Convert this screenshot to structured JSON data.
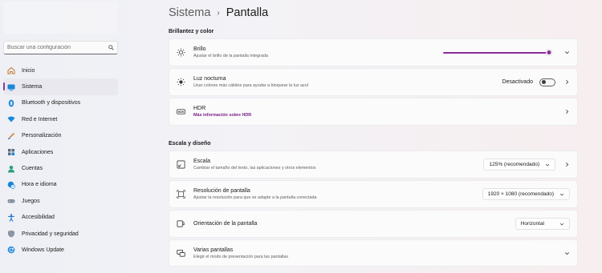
{
  "search": {
    "placeholder": "Buscar una configuración"
  },
  "sidebar": {
    "items": [
      {
        "label": "Inicio",
        "icon": "home-icon"
      },
      {
        "label": "Sistema",
        "icon": "system-icon",
        "active": true
      },
      {
        "label": "Bluetooth y dispositivos",
        "icon": "bluetooth-icon"
      },
      {
        "label": "Red e Internet",
        "icon": "wifi-icon"
      },
      {
        "label": "Personalización",
        "icon": "brush-icon"
      },
      {
        "label": "Aplicaciones",
        "icon": "apps-icon"
      },
      {
        "label": "Cuentas",
        "icon": "account-icon"
      },
      {
        "label": "Hora e idioma",
        "icon": "globe-clock-icon"
      },
      {
        "label": "Juegos",
        "icon": "gamepad-icon"
      },
      {
        "label": "Accesibilidad",
        "icon": "accessibility-icon"
      },
      {
        "label": "Privacidad y seguridad",
        "icon": "shield-icon"
      },
      {
        "label": "Windows Update",
        "icon": "update-icon"
      }
    ]
  },
  "breadcrumb": {
    "parent": "Sistema",
    "separator": "›",
    "current": "Pantalla"
  },
  "sections": {
    "brightness_color": "Brillantez y color",
    "scale_layout": "Escala y diseño"
  },
  "cards": {
    "brightness": {
      "title": "Brillo",
      "subtitle": "Ajustar el brillo de la pantalla integrada",
      "level": 0.97
    },
    "night_light": {
      "title": "Luz nocturna",
      "subtitle": "Usar colores más cálidos para ayudar a bloquear la luz azul",
      "state": "Desactivado"
    },
    "hdr": {
      "title": "HDR",
      "link": "Más información sobre HDR"
    },
    "scale": {
      "title": "Escala",
      "subtitle": "Cambiar el tamaño del texto, las aplicaciones y otros elementos",
      "value": "125% (recomendado)"
    },
    "resolution": {
      "title": "Resolución de pantalla",
      "subtitle": "Ajustar la resolución para que se adapte a la pantalla conectada",
      "value": "1920 × 1080 (recomendado)"
    },
    "orientation": {
      "title": "Orientación de la pantalla",
      "value": "Horizontal"
    },
    "multiple": {
      "title": "Varias pantallas",
      "subtitle": "Elegir el modo de presentación para las pantallas"
    }
  },
  "colors": {
    "accent": "#8a2d98",
    "link": "#7a1f86"
  }
}
